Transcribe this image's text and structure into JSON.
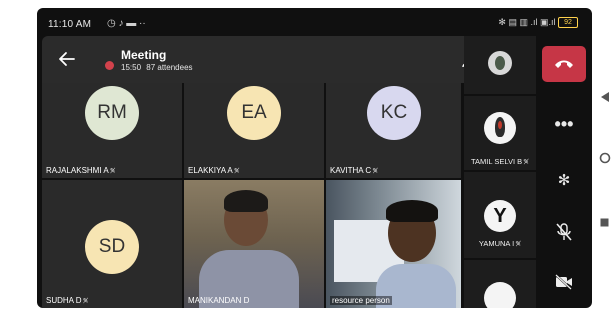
{
  "status": {
    "time": "11:10 AM",
    "battery": "92"
  },
  "meeting": {
    "title": "Meeting",
    "duration": "15:50",
    "attendees": "87 attendees"
  },
  "grid": [
    {
      "initials": "RM",
      "name": "RAJALAKSHMI A",
      "color": "#dfe7d3"
    },
    {
      "initials": "EA",
      "name": "ELAKKIYA A",
      "color": "#f7e5b3"
    },
    {
      "initials": "KC",
      "name": "KAVITHA C",
      "color": "#d8d8ef"
    },
    {
      "initials": "SD",
      "name": "SUDHA D",
      "color": "#f7e5b3"
    },
    {
      "name": "MANIKANDAN D"
    },
    {
      "name": "resource person"
    }
  ],
  "right_rail": [
    {
      "name": "TAMIL SELVI B"
    },
    {
      "initials": "Y",
      "name": "YAMUNA I"
    }
  ],
  "colors": {
    "hangup": "#c63646",
    "record": "#d2424c"
  }
}
